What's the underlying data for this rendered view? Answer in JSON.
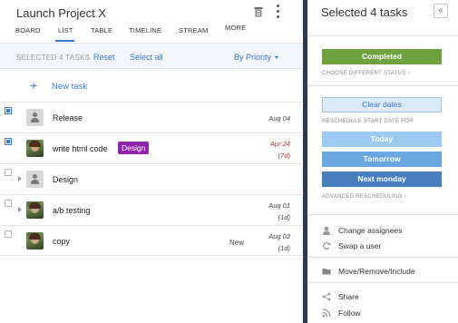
{
  "project": {
    "title": "Launch Project X"
  },
  "tabs": [
    "BOARD",
    "LIST",
    "TABLE",
    "TIMELINE",
    "STREAM",
    "MORE"
  ],
  "active_tab": "LIST",
  "selection_bar": {
    "count_text": "SELECTED 4 TASKS",
    "reset_label": "Reset",
    "select_all_label": "Select all",
    "sort_label": "By Priority"
  },
  "new_task_label": "New task",
  "tasks": [
    {
      "name": "Release",
      "date": "Aug 04",
      "sub": "",
      "badge": "",
      "checked": true,
      "overdue": false,
      "expandable": false,
      "avatar": "generic",
      "status": ""
    },
    {
      "name": "write html code",
      "date": "Apr 24",
      "sub": "(7d)",
      "badge": "Design",
      "checked": true,
      "overdue": true,
      "expandable": false,
      "avatar": "photo",
      "status": ""
    },
    {
      "name": "Design",
      "date": "",
      "sub": "",
      "badge": "",
      "checked": false,
      "overdue": false,
      "expandable": true,
      "avatar": "generic",
      "status": ""
    },
    {
      "name": "a/b testing",
      "date": "Aug 01",
      "sub": "(1d)",
      "badge": "",
      "checked": false,
      "overdue": false,
      "expandable": true,
      "avatar": "photo",
      "status": ""
    },
    {
      "name": "copy",
      "date": "Aug 02",
      "sub": "(1d)",
      "badge": "",
      "checked": false,
      "overdue": false,
      "expandable": false,
      "avatar": "photo",
      "status": "New"
    }
  ],
  "panel": {
    "title": "Selected 4 tasks",
    "collapse_glyph": "«",
    "completed_label": "Completed",
    "choose_status_label": "CHOOSE DIFFERENT STATUS",
    "clear_dates_label": "Clear dates",
    "reschedule_label": "RESCHEDULE START DATE FOR",
    "today_label": "Today",
    "tomorrow_label": "Tomorrow",
    "next_monday_label": "Next monday",
    "advanced_label": "ADVANCED RESCHEDULING",
    "actions": {
      "change_assignees": "Change assignees",
      "swap_user": "Swap a user",
      "move": "Move/Remove/Include",
      "share": "Share",
      "follow": "Follow"
    }
  },
  "colors": {
    "accent": "#3c78d8",
    "completed": "#6ea23f",
    "badge": "#8e24aa",
    "overdue": "#b43232",
    "divider": "#2b3a4e"
  }
}
